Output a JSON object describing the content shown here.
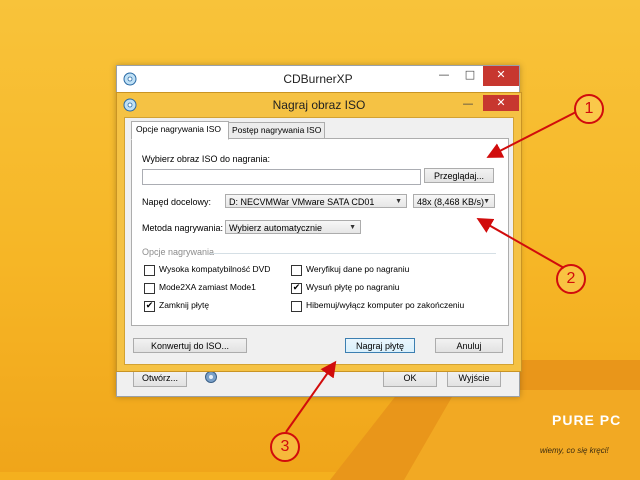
{
  "main_window": {
    "title": "CDBurnerXP",
    "open_label": "Otwórz...",
    "ok_label": "OK",
    "exit_label": "Wyjście"
  },
  "dialog": {
    "title": "Nagraj obraz ISO",
    "tabs": [
      "Opcje nagrywania ISO",
      "Postęp nagrywania ISO"
    ],
    "choose_iso_label": "Wybierz obraz ISO do nagrania:",
    "iso_path_value": "",
    "browse_label": "Przeglądaj...",
    "target_drive_label": "Napęd docelowy:",
    "target_drive_value": "D: NECVMWar VMware SATA CD01",
    "speed_value": "48x (8,468 KB/s)",
    "method_label": "Metoda nagrywania:",
    "method_value": "Wybierz automatycznie",
    "options_group": "Opcje nagrywania",
    "options": [
      {
        "label": "Wysoka kompatybilność DVD",
        "checked": false
      },
      {
        "label": "Weryfikuj dane po nagraniu",
        "checked": false
      },
      {
        "label": "Mode2XA zamiast Mode1",
        "checked": false
      },
      {
        "label": "Wysuń płytę po nagraniu",
        "checked": true
      },
      {
        "label": "Zamknij płytę",
        "checked": true
      },
      {
        "label": "Hibemuj/wyłącz komputer po zakończeniu",
        "checked": false
      }
    ],
    "convert_label": "Konwertuj do ISO...",
    "burn_label": "Nagraj płytę",
    "cancel_label": "Anuluj"
  },
  "callouts": [
    "1",
    "2",
    "3"
  ],
  "watermark": {
    "brand": "PURE PC",
    "tagline": "wiemy, co się kręci!"
  },
  "colors": {
    "desktop": "#f4b01e",
    "dialog_frame": "#f5c244",
    "callout": "#d10c0c",
    "close_button": "#c7372f"
  }
}
